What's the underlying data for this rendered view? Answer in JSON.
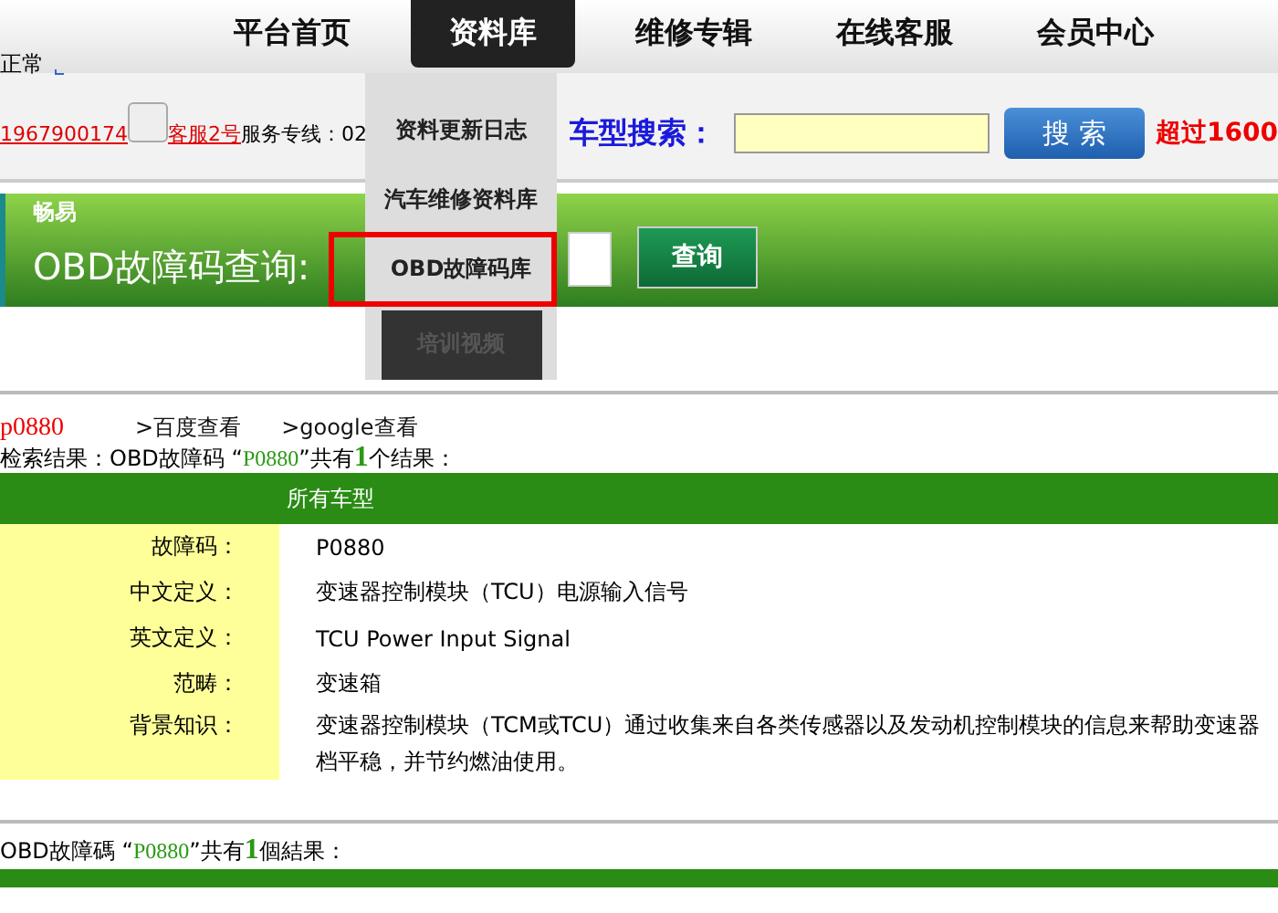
{
  "nav": {
    "items": [
      {
        "label": "平台首页",
        "selected": false
      },
      {
        "label": "资料库",
        "selected": true
      },
      {
        "label": "维修专辑",
        "selected": false
      },
      {
        "label": "在线客服",
        "selected": false
      },
      {
        "label": "会员中心",
        "selected": false
      }
    ]
  },
  "status": {
    "text": "正常"
  },
  "contact": {
    "qq_number": "1967900174",
    "service_name": "客服2号",
    "hotline": "服务专线：02"
  },
  "model_search": {
    "label": "车型搜索：",
    "button": "搜 索",
    "promo": "超过1600"
  },
  "banner": {
    "brand": "畅易",
    "title": "OBD故障码查询:",
    "button": "查询"
  },
  "dropdown": {
    "items": [
      {
        "label": "资料更新日志",
        "selected": false,
        "disabled": false
      },
      {
        "label": "汽车维修资料库",
        "selected": false,
        "disabled": false
      },
      {
        "label": "OBD故障码库",
        "selected": true,
        "disabled": false
      },
      {
        "label": "培训视频",
        "selected": false,
        "disabled": true
      }
    ]
  },
  "query": {
    "code": "p0880",
    "links": [
      ">百度查看",
      ">google查看"
    ]
  },
  "results": [
    {
      "summary": {
        "prefix": "检索结果：OBD故障码 “",
        "code": "P0880",
        "middle": "”共有",
        "count": "1",
        "suffix": "个结果："
      },
      "header": "所有车型",
      "rows": [
        {
          "label": "故障码：",
          "value": "P0880"
        },
        {
          "label": "中文定义：",
          "value": "变速器控制模块（TCU）电源输入信号"
        },
        {
          "label": "英文定义：",
          "value": "TCU Power Input Signal"
        },
        {
          "label": "范畴：",
          "value": "变速箱"
        },
        {
          "label": "背景知识：",
          "value": "变速器控制模块（TCM或TCU）通过收集来自各类传感器以及发动机控制模块的信息来帮助变速器"
        },
        {
          "label": "",
          "value": "档平稳，并节约燃油使用。"
        }
      ]
    },
    {
      "summary": {
        "prefix": "OBD故障碼 “",
        "code": "P0880",
        "middle": "”共有",
        "count": "1",
        "suffix": "個結果："
      }
    }
  ]
}
